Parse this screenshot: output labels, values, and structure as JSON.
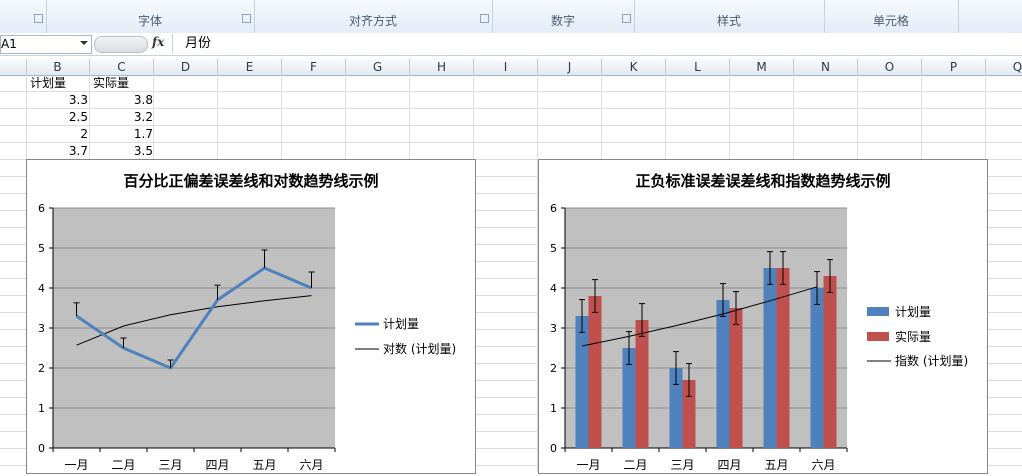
{
  "ribbon": {
    "groups": [
      {
        "label": "字体"
      },
      {
        "label": "对齐方式"
      },
      {
        "label": "数字"
      },
      {
        "label": "样式"
      },
      {
        "label": "单元格"
      }
    ]
  },
  "formula_bar": {
    "name_box": "A1",
    "fx": "fx",
    "content": "月份"
  },
  "columns": [
    "B",
    "C",
    "D",
    "E",
    "F",
    "G",
    "H",
    "I",
    "J",
    "K",
    "L",
    "M",
    "N",
    "O",
    "P",
    "Q"
  ],
  "sheet": {
    "header_b": "计划量",
    "header_c": "实际量",
    "rows": [
      [
        "3.3",
        "3.8"
      ],
      [
        "2.5",
        "3.2"
      ],
      [
        "2",
        "1.7"
      ],
      [
        "3.7",
        "3.5"
      ]
    ]
  },
  "chart_data": [
    {
      "type": "line",
      "title": "百分比正偏差误差线和对数趋势线示例",
      "categories": [
        "一月",
        "二月",
        "三月",
        "四月",
        "五月",
        "六月"
      ],
      "series": [
        {
          "name": "计划量",
          "values": [
            3.3,
            2.5,
            2.0,
            3.7,
            4.5,
            4.0
          ],
          "error_plus_percent": 10
        }
      ],
      "trendline": {
        "name": "对数 (计划量)",
        "values": [
          2.57,
          3.05,
          3.33,
          3.53,
          3.68,
          3.81
        ]
      },
      "ylim": [
        0,
        6
      ],
      "yticks": [
        "0",
        "1",
        "2",
        "3",
        "4",
        "5",
        "6"
      ],
      "grid": true,
      "legend_position": "right",
      "colors": {
        "series": "#4f81bd",
        "trend": "#000000",
        "plot_bg": "#c0c0c0"
      }
    },
    {
      "type": "bar",
      "title": "正负标准误差误差线和指数趋势线示例",
      "categories": [
        "一月",
        "二月",
        "三月",
        "四月",
        "五月",
        "六月"
      ],
      "series": [
        {
          "name": "计划量",
          "values": [
            3.3,
            2.5,
            2.0,
            3.7,
            4.5,
            4.0
          ]
        },
        {
          "name": "实际量",
          "values": [
            3.8,
            3.2,
            1.7,
            3.5,
            4.5,
            4.3
          ]
        }
      ],
      "error_bar": 0.41,
      "trendline": {
        "name": "指数 (计划量)",
        "values": [
          2.55,
          2.79,
          3.06,
          3.35,
          3.68,
          4.03
        ]
      },
      "ylim": [
        0,
        6
      ],
      "yticks": [
        "0",
        "1",
        "2",
        "3",
        "4",
        "5",
        "6"
      ],
      "grid": true,
      "legend_position": "right",
      "colors": {
        "series1": "#4f81bd",
        "series2": "#c0504d",
        "trend": "#000000",
        "plot_bg": "#c0c0c0"
      }
    }
  ]
}
